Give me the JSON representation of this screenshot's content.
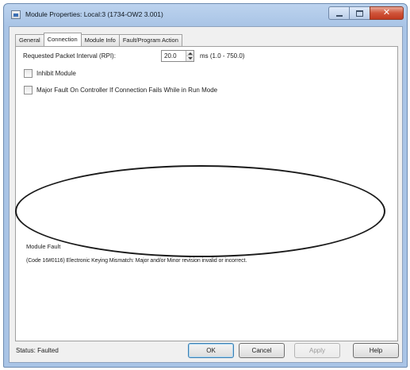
{
  "window": {
    "title": "Module Properties: Local:3 (1734-OW2 3.001)",
    "controls": {
      "minimize_icon": "minimize-icon",
      "maximize_icon": "maximize-icon",
      "close_glyph": "✕"
    }
  },
  "tabs": [
    {
      "label": "General",
      "active": false
    },
    {
      "label": "Connection",
      "active": true
    },
    {
      "label": "Module Info",
      "active": false
    },
    {
      "label": "Fault/Program Action",
      "active": false
    }
  ],
  "connection": {
    "rpi_label": "Requested Packet Interval (RPI):",
    "rpi_value": "20.0",
    "rpi_range": "ms (1.0 - 750.0)",
    "inhibit_module_label": "Inhibit Module",
    "inhibit_module_checked": false,
    "major_fault_label": "Major Fault On Controller If Connection Fails While in Run Mode",
    "major_fault_checked": false
  },
  "fault": {
    "title": "Module Fault",
    "message": "(Code 16#0116) Electronic Keying Mismatch: Major and/or Minor revision invalid or incorrect."
  },
  "footer": {
    "status": "Status:  Faulted",
    "buttons": {
      "ok": "OK",
      "cancel": "Cancel",
      "apply": "Apply",
      "help": "Help"
    }
  },
  "colors": {
    "title_bar": "#a9c4e6",
    "close_button": "#c13a20",
    "annotation_ellipse": "#1a1a1a"
  }
}
